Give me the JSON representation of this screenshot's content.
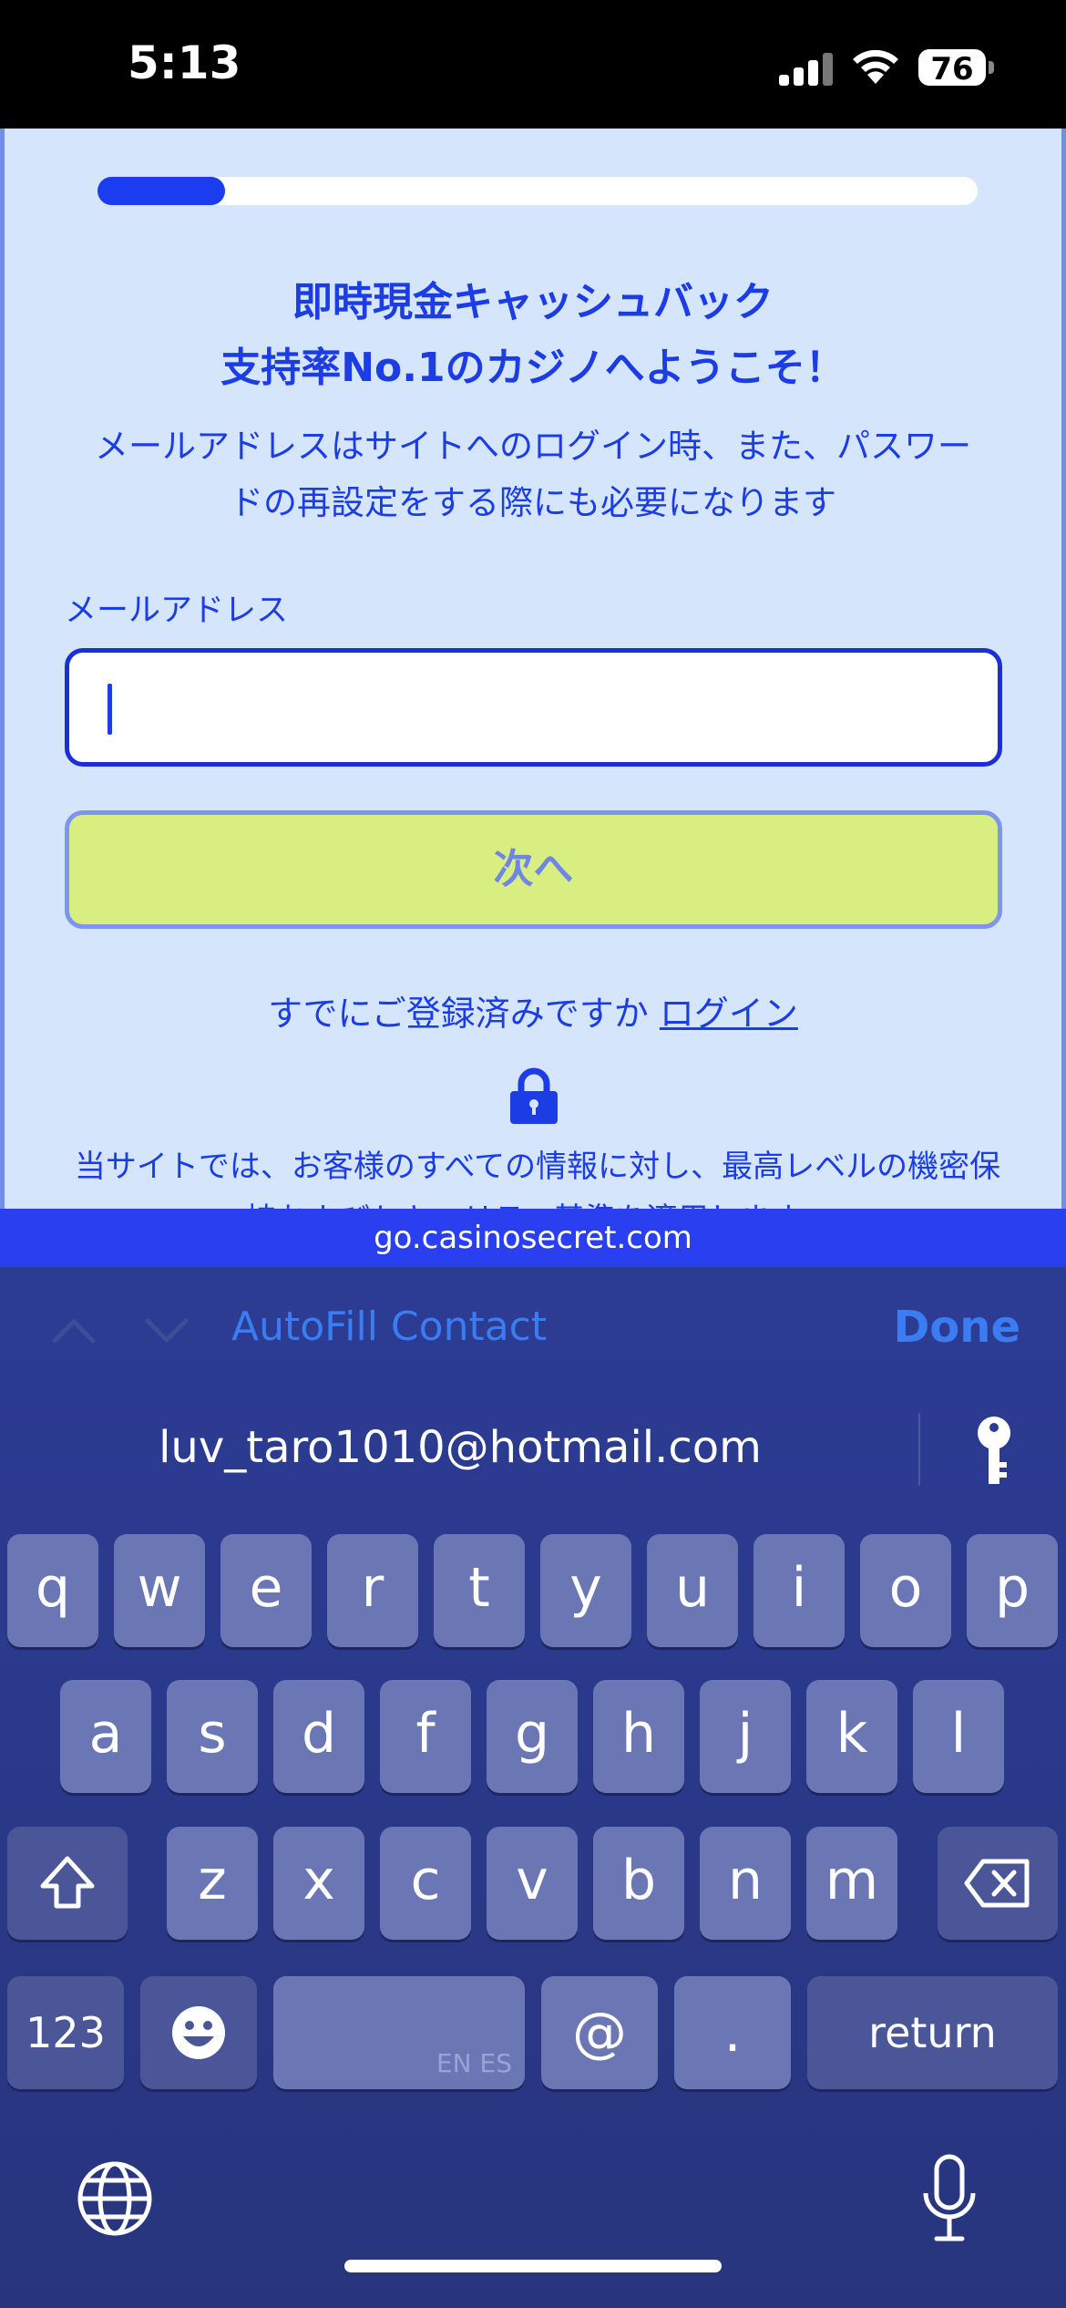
{
  "status_bar": {
    "time": "5:13",
    "battery": "76"
  },
  "page": {
    "progress_fraction": 0.145,
    "headline_line1": "即時現金キャッシュバック",
    "headline_line2": "支持率No.1のカジノへようこそ！",
    "description_line1": "メールアドレスはサイトへのログイン時、また、パスワー",
    "description_line2": "ドの再設定をする際にも必要になります",
    "email_label": "メールアドレス",
    "email_value": "",
    "next_label": "次へ",
    "login_prompt": "すでにご登録済みですか",
    "login_link": "ログイン",
    "security_line1": "当サイトでは、お客様のすべての情報に対し、最高レベルの機密保",
    "security_line2": "持およびセキュリティ基準を適用します。",
    "colors": {
      "accent": "#1c3ce6",
      "background": "#d5e6fc",
      "button": "#d9ee80"
    }
  },
  "url_bar": {
    "url": "go.casinosecret.com"
  },
  "keyboard": {
    "accessory": {
      "autofill_label": "AutoFill Contact",
      "done_label": "Done",
      "prev_icon": "chevron-up-icon",
      "next_icon": "chevron-down-icon"
    },
    "suggestion": "luv_taro1010@hotmail.com",
    "row1": [
      "q",
      "w",
      "e",
      "r",
      "t",
      "y",
      "u",
      "i",
      "o",
      "p"
    ],
    "row2": [
      "a",
      "s",
      "d",
      "f",
      "g",
      "h",
      "j",
      "k",
      "l"
    ],
    "row3": [
      "z",
      "x",
      "c",
      "v",
      "b",
      "n",
      "m"
    ],
    "bottom": {
      "numbers": "123",
      "space_hint": "EN ES",
      "at": "@",
      "dot": ".",
      "return": "return"
    }
  }
}
